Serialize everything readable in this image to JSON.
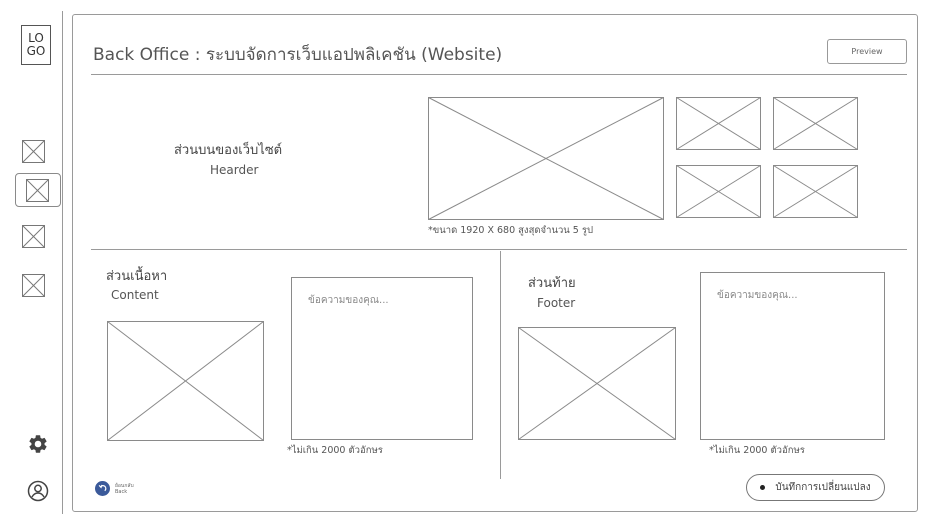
{
  "sidebar": {
    "logo_line1": "LO",
    "logo_line2": "GO",
    "items": [
      {
        "icon": "image-placeholder-icon"
      },
      {
        "icon": "image-placeholder-icon"
      },
      {
        "icon": "image-placeholder-icon"
      },
      {
        "icon": "image-placeholder-icon"
      }
    ],
    "settings_icon": "gear-icon",
    "profile_icon": "user-icon"
  },
  "header": {
    "title": "Back Office : ระบบจัดการเว็บแอปพลิเคชัน (Website)",
    "preview_label": "Preview"
  },
  "sections": {
    "top": {
      "title_th": "ส่วนบนของเว็บไซต์",
      "title_en": "Hearder",
      "image_note": "*ขนาด 1920 X 680 สูงสุดจำนวน 5 รูป"
    },
    "content": {
      "title_th": "ส่วนเนื้อหา",
      "title_en": "Content",
      "textbox_placeholder": "ข้อความของคุณ...",
      "text_note": "*ไม่เกิน 2000 ตัวอักษร"
    },
    "footer": {
      "title_th": "ส่วนท้าย",
      "title_en": "Footer",
      "textbox_placeholder": "ข้อความของคุณ...",
      "text_note": "*ไม่เกิน 2000 ตัวอักษร"
    }
  },
  "actions": {
    "back_label_th": "ย้อนกลับ",
    "back_label_en": "Back",
    "save_label": "บันทึกการเปลี่ยนแปลง"
  }
}
